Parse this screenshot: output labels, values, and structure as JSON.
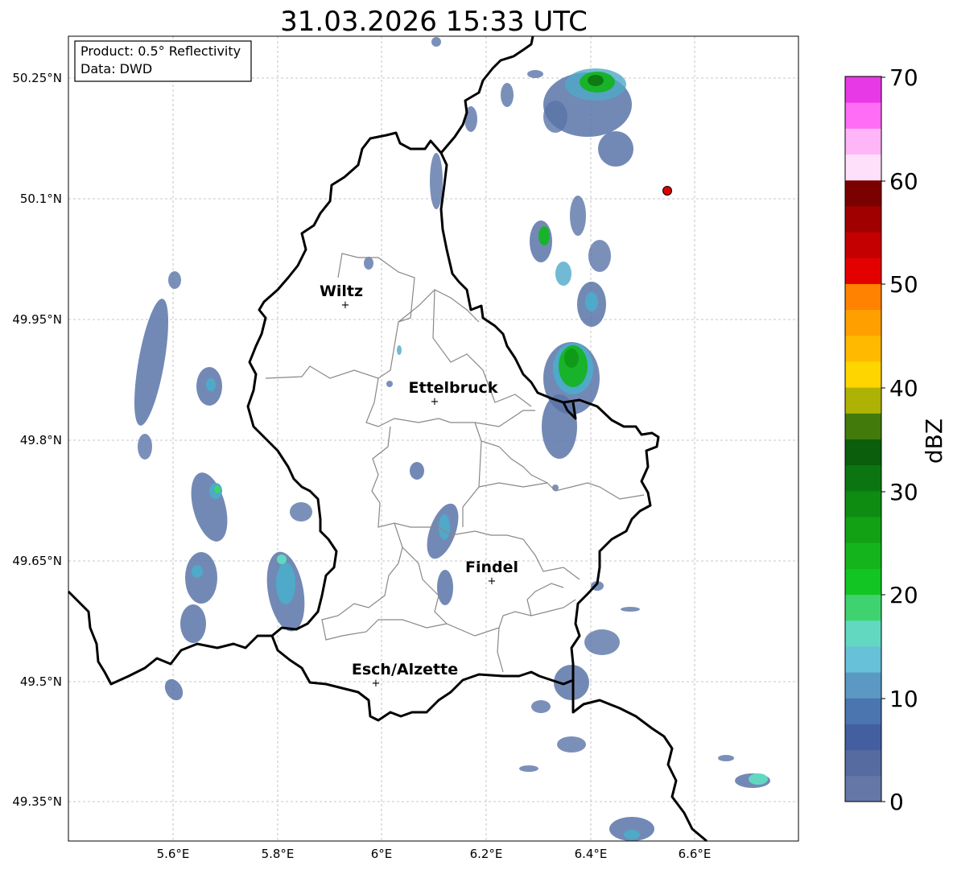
{
  "map": {
    "title": "31.03.2026 15:33 UTC",
    "info_box": {
      "product": "Product: 0.5° Reflectivity",
      "data_source": "Data: DWD"
    },
    "longitude_ticks": [
      "5.6°E",
      "5.8°E",
      "6°E",
      "6.2°E",
      "6.4°E",
      "6.6°E"
    ],
    "latitude_ticks": [
      "50.25°N",
      "50.1°N",
      "49.95°N",
      "49.8°N",
      "49.65°N",
      "49.5°N",
      "49.35°N"
    ],
    "gridlines": true,
    "cities": [
      {
        "name": "Wiltz"
      },
      {
        "name": "Ettelbruck"
      },
      {
        "name": "Findel"
      },
      {
        "name": "Esch/Alzette"
      }
    ],
    "radar_site_marker": {
      "color": "#e00000"
    }
  },
  "colorbar": {
    "label": "dBZ",
    "ticks": [
      "0",
      "10",
      "20",
      "30",
      "40",
      "50",
      "60",
      "70"
    ],
    "colors": [
      "#6577a6",
      "#566ba0",
      "#445fa0",
      "#4a75ae",
      "#5b99c4",
      "#67c1d9",
      "#62d8c0",
      "#3fd36f",
      "#12c523",
      "#14b51c",
      "#12a115",
      "#0e8c12",
      "#0b7611",
      "#0a5e0c",
      "#427a0b",
      "#aeb204",
      "#ffd500",
      "#ffba00",
      "#ffa000",
      "#ff8200",
      "#e50000",
      "#c40000",
      "#a00000",
      "#7b0000",
      "#ffe0fb",
      "#ffb6f9",
      "#ff6cf5",
      "#e839e6"
    ]
  }
}
